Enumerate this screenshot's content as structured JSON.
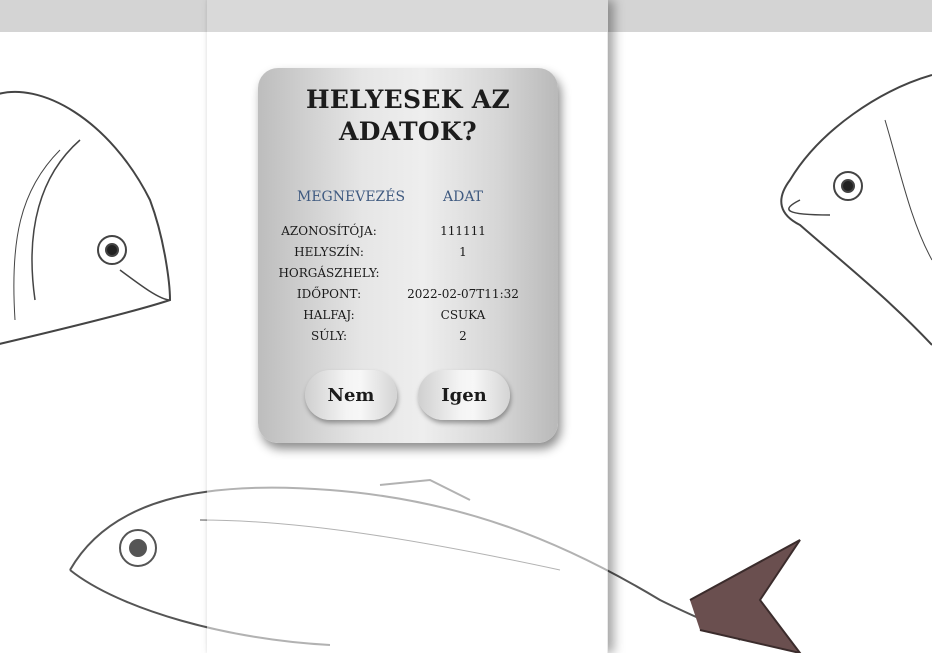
{
  "dialog": {
    "title": "HELYESEK AZ ADATOK?",
    "header_left": "MEGNEVEZÉS",
    "header_right": "ADAT",
    "rows": [
      {
        "label": "AZONOSÍTÓJA:",
        "value": "111111"
      },
      {
        "label": "HELYSZÍN:",
        "value": "1"
      },
      {
        "label": "HORGÁSZHELY:",
        "value": ""
      },
      {
        "label": "IDŐPONT:",
        "value": "2022-02-07T11:32"
      },
      {
        "label": "HALFAJ:",
        "value": "CSUKA"
      },
      {
        "label": "SÚLY:",
        "value": "2"
      }
    ],
    "buttons": {
      "no": "Nem",
      "yes": "Igen"
    }
  },
  "colors": {
    "header_text": "#3f5a80",
    "top_bar": "#d4d4d4"
  },
  "icons": [
    "fish-illustration-left",
    "fish-illustration-right",
    "fish-illustration-bottom"
  ]
}
